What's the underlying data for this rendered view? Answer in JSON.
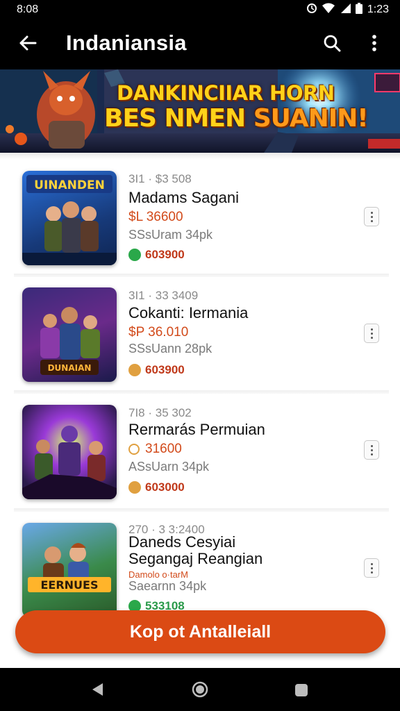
{
  "status_bar": {
    "time": "8:08",
    "battery_text": "1:23"
  },
  "app_bar": {
    "title": "Indaniansia"
  },
  "banner": {
    "line1": "DANKINCIIAR HORN",
    "line2_a": "BES NMEN ",
    "line2_b": "SUANIN!"
  },
  "items": [
    {
      "meta": "3I1 · $3 508",
      "title": "Madams Sagani",
      "title2": "",
      "price": "$L 36600",
      "subline": "",
      "size": "SSsUram 34pk",
      "coins": "603900",
      "coin_color": "#2aa84a",
      "coin_text_color": "#c0391a"
    },
    {
      "meta": "3I1 · 33 3409",
      "title": "Cokanti: Iermania",
      "title2": "",
      "price": "$P 36.010",
      "subline": "",
      "size": "SSsUann 28pk",
      "coins": "603900",
      "coin_color": "#e0a040",
      "coin_text_color": "#c0391a"
    },
    {
      "meta": "7I8 · 35 302",
      "title": "Rermarás Permuian",
      "title2": "",
      "price": "31600",
      "subline": "",
      "size": "ASsUarn 34pk",
      "coins": "603000",
      "coin_color": "#e0a040",
      "coin_text_color": "#c0391a"
    },
    {
      "meta": "270 · 3 3:2400",
      "title": "Daneds Cesyiai",
      "title2": "Seganga‌j Reangian",
      "price": "",
      "subline": "Damolo o·tarM",
      "size": "Saearnn 34pk",
      "coins": "533108",
      "coin_color": "#2aa84a",
      "coin_text_color": "#2a9a4a"
    }
  ],
  "install_button": {
    "label": "Kop ot Antalleiall"
  },
  "icons": {
    "back": "arrow-left-icon",
    "search": "search-icon",
    "more": "more-vert-icon",
    "item_menu": "kebab-menu-icon",
    "nav_back": "nav-back-icon",
    "nav_home": "nav-home-icon",
    "nav_recent": "nav-recent-icon"
  }
}
